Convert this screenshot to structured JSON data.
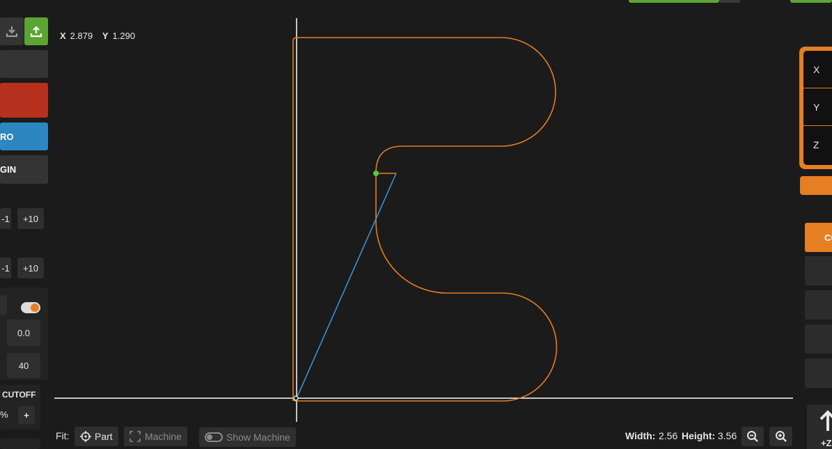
{
  "left_panel": {
    "actions_label": "",
    "red_button": "",
    "zero_button": "RO",
    "origin_button": "GIN",
    "step_row1": {
      "minus": "-1",
      "plus": "+10"
    },
    "step_row2": {
      "minus": "-1",
      "plus": "+10"
    },
    "field_a": "0.0",
    "field_b": "40",
    "cutoff_label": "CUTOFF",
    "percent_label": "%",
    "plus_label": "+"
  },
  "coords": {
    "x_label": "X",
    "x_value": "2.879",
    "y_label": "Y",
    "y_value": "1.290"
  },
  "bottom": {
    "fit_label": "Fit:",
    "part_button": "Part",
    "machine_button": "Machine",
    "show_machine_toggle": "Show Machine",
    "width_label": "Width:",
    "width_value": "2.56",
    "height_label": "Height:",
    "height_value": "3.56"
  },
  "dro": {
    "x_label": "X",
    "y_label": "Y",
    "z_label": "Z"
  },
  "right_panel": {
    "orange_button": "CO",
    "jog_label": "+Z"
  },
  "colors": {
    "accent": "#e67e22",
    "green": "#5ba532",
    "red": "#b72f1d",
    "blue": "#2e86c1",
    "path": "#e67e22",
    "lead_in": "#3d8fd1",
    "start_point": "#5ac93b"
  },
  "icons": [
    "download-icon",
    "upload-icon",
    "crosshair-icon",
    "expand-icon",
    "toggle-icon",
    "zoom-out-icon",
    "zoom-in-icon",
    "arrow-up-icon"
  ]
}
